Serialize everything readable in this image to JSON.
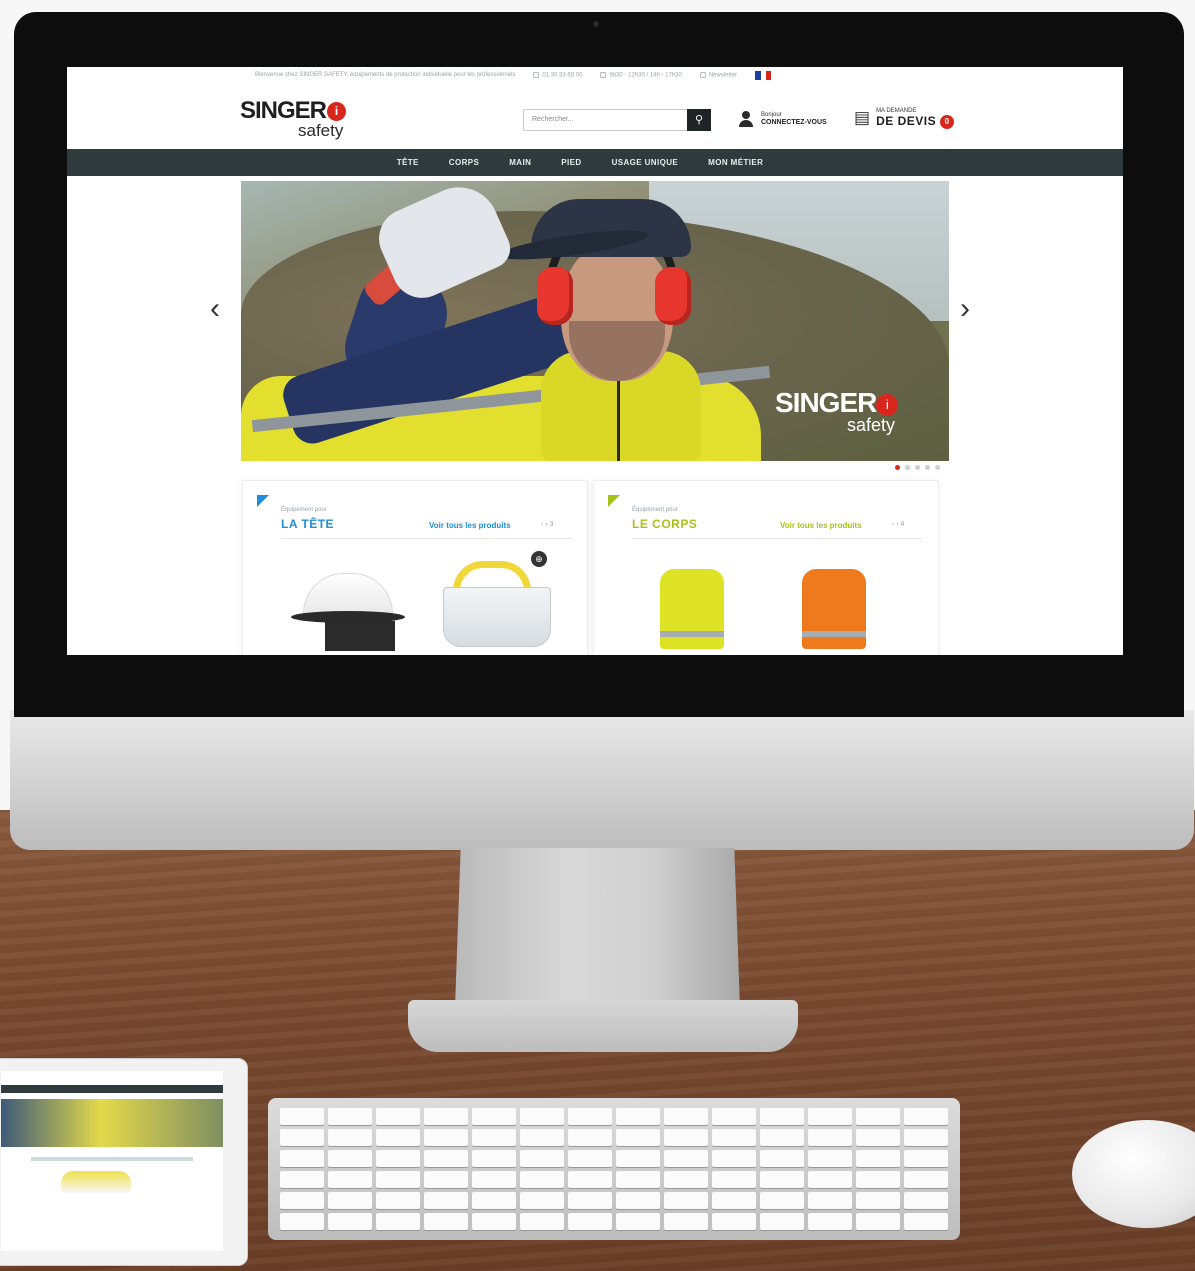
{
  "site": {
    "topbar": {
      "notice": "Bienvenue chez SINGER SAFETY, équipements de protection individuelle pour les professionnels",
      "phone": "01 30 33 60 00",
      "hours": "9h30 - 12h30 / 14h - 17h30",
      "newsletter": "Newsletter"
    },
    "logo": {
      "word": "SINGER",
      "sub": "safety",
      "mark": "i"
    },
    "search": {
      "placeholder": "Rechercher...",
      "button_icon": "search-icon"
    },
    "account": {
      "line1": "Bonjour",
      "line2": "CONNECTEZ-VOUS"
    },
    "quote": {
      "line1": "MA DEMANDE",
      "line2": "DE DEVIS",
      "count": "0"
    },
    "nav": [
      "TÊTE",
      "CORPS",
      "MAIN",
      "PIED",
      "USAGE UNIQUE",
      "MON MÉTIER"
    ],
    "hero": {
      "logo_word": "SINGER",
      "logo_mark": "i",
      "logo_sub": "safety",
      "prev_icon": "‹",
      "next_icon": "›",
      "slide_count": 5,
      "active_slide": 1
    },
    "categories": [
      {
        "kicker": "Équipement pour",
        "title": "LA TÊTE",
        "link": "Voir tous les produits",
        "pager": "‹  ›  3",
        "accent": "#1e8fd8"
      },
      {
        "kicker": "Équipement pour",
        "title": "LE CORPS",
        "link": "Voir tous les produits",
        "pager": "‹  ›  4",
        "accent": "#a6c21b"
      }
    ]
  },
  "colors": {
    "brand_red": "#d9261c",
    "nav_bg": "#2e3a3c",
    "hi_vis_yellow": "#dde324",
    "hi_vis_orange": "#ef7a1e"
  }
}
